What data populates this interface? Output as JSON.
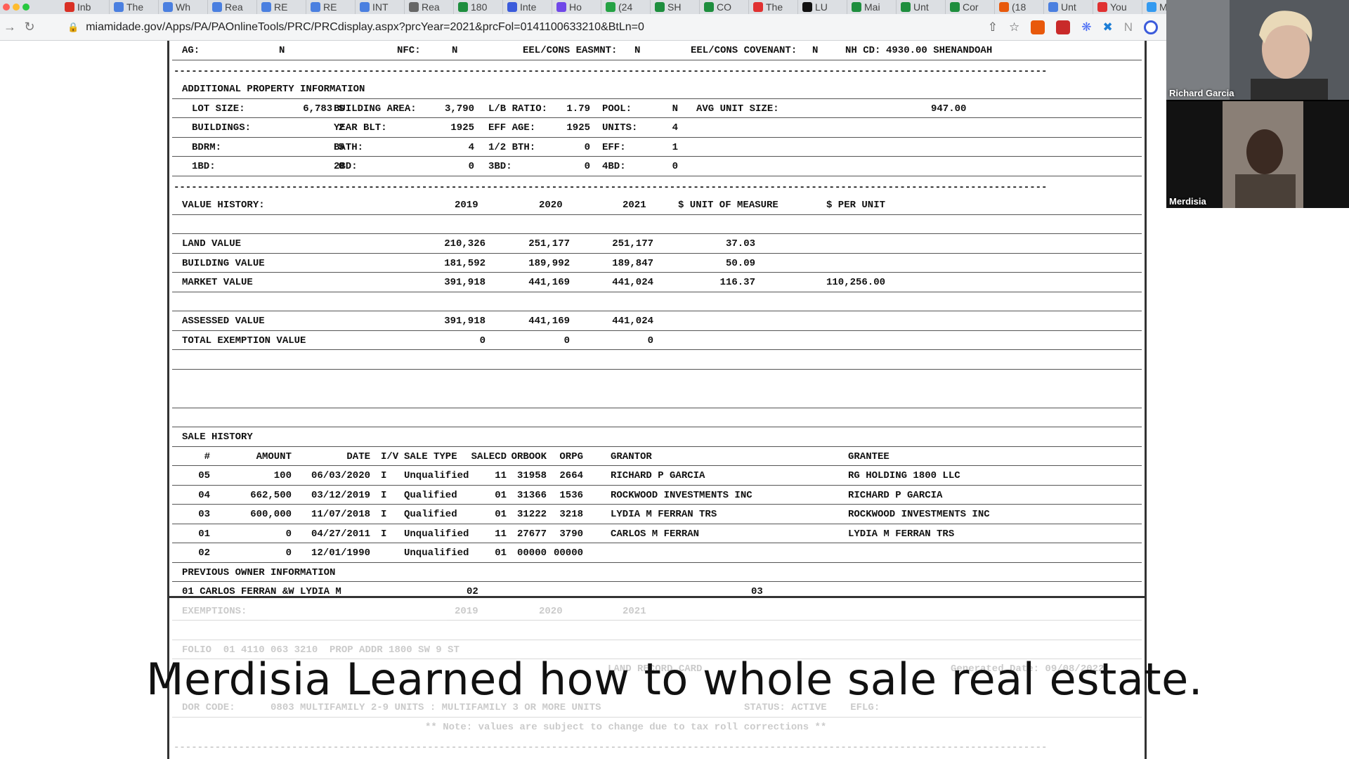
{
  "browser": {
    "tabs": [
      {
        "label": "Inb",
        "color": "#d93025"
      },
      {
        "label": "The",
        "color": "#4a7fe0"
      },
      {
        "label": "Wh",
        "color": "#4a7fe0"
      },
      {
        "label": "Rea",
        "color": "#4a7fe0"
      },
      {
        "label": "RE",
        "color": "#4a7fe0"
      },
      {
        "label": "RE",
        "color": "#4a7fe0"
      },
      {
        "label": "INT",
        "color": "#4a7fe0"
      },
      {
        "label": "Rea",
        "color": "#666"
      },
      {
        "label": "180",
        "color": "#1e8e3e"
      },
      {
        "label": "Inte",
        "color": "#3b5bdb"
      },
      {
        "label": "Ho",
        "color": "#7048e8"
      },
      {
        "label": "(24",
        "color": "#25a244"
      },
      {
        "label": "SH",
        "color": "#1e8e3e"
      },
      {
        "label": "CO",
        "color": "#1e8e3e"
      },
      {
        "label": "The",
        "color": "#e03131"
      },
      {
        "label": "LU",
        "color": "#111"
      },
      {
        "label": "Mai",
        "color": "#1e8e3e"
      },
      {
        "label": "Unt",
        "color": "#1e8e3e"
      },
      {
        "label": "Cor",
        "color": "#1e8e3e"
      },
      {
        "label": "(18",
        "color": "#e8590c"
      },
      {
        "label": "Unt",
        "color": "#4a7fe0"
      },
      {
        "label": "You",
        "color": "#e03131"
      },
      {
        "label": "Mo",
        "color": "#339af0"
      }
    ],
    "url": "miamidade.gov/Apps/PA/PAOnlineTools/PRC/PRCdisplay.aspx?prcYear=2021&prcFol=0141100633210&BtLn=0"
  },
  "document": {
    "top_row": {
      "ag_label": "AG:",
      "ag_value": "N",
      "nfc_label": "NFC:",
      "nfc_value": "N",
      "eel_easmnt_label": "EEL/CONS EASMNT:",
      "eel_easmnt_value": "N",
      "eel_cov_label": "EEL/CONS COVENANT:",
      "eel_cov_value": "N",
      "nh_cd_label": "NH CD:",
      "nh_cd_value": "4930.00 SHENANDOAH"
    },
    "dashes": "----------------------------------------------------------------------------------------------------------------------------------------------------",
    "additional_title": "ADDITIONAL PROPERTY INFORMATION",
    "additional_rows": [
      [
        {
          "label": "LOT SIZE:",
          "value": "6,783 S"
        },
        {
          "label": "BUILDING AREA:",
          "value": "3,790"
        },
        {
          "label": "L/B RATIO:",
          "value": "1.79"
        },
        {
          "label": "POOL:",
          "value": "N"
        },
        {
          "label": "AVG UNIT SIZE:",
          "value": "947.00"
        }
      ],
      [
        {
          "label": "BUILDINGS:",
          "value": "2"
        },
        {
          "label": "YEAR BLT:",
          "value": "1925"
        },
        {
          "label": "EFF AGE:",
          "value": "1925"
        },
        {
          "label": "UNITS:",
          "value": "4"
        }
      ],
      [
        {
          "label": "BDRM:",
          "value": "5"
        },
        {
          "label": "BATH:",
          "value": "4"
        },
        {
          "label": "1/2 BTH:",
          "value": "0"
        },
        {
          "label": "EFF:",
          "value": "1"
        }
      ],
      [
        {
          "label": "1BD:",
          "value": "0"
        },
        {
          "label": "2BD:",
          "value": "0"
        },
        {
          "label": "3BD:",
          "value": "0"
        },
        {
          "label": "4BD:",
          "value": "0"
        }
      ]
    ],
    "value_history": {
      "title": "VALUE HISTORY:",
      "years": [
        "2019",
        "2020",
        "2021"
      ],
      "unit_header": "$ UNIT OF MEASURE",
      "per_unit_header": "$ PER UNIT",
      "land": {
        "label": "LAND VALUE",
        "values": [
          "210,326",
          "251,177",
          "251,177"
        ],
        "unit": "37.03",
        "per": ""
      },
      "building": {
        "label": "BUILDING VALUE",
        "values": [
          "181,592",
          "189,992",
          "189,847"
        ],
        "unit": "50.09",
        "per": ""
      },
      "market": {
        "label": "MARKET VALUE",
        "values": [
          "391,918",
          "441,169",
          "441,024"
        ],
        "unit": "116.37",
        "per": "110,256.00"
      },
      "assessed": {
        "label": "ASSESSED VALUE",
        "values": [
          "391,918",
          "441,169",
          "441,024"
        ]
      },
      "exemption": {
        "label": "TOTAL EXEMPTION VALUE",
        "values": [
          "0",
          "0",
          "0"
        ]
      }
    },
    "sale_history": {
      "title": "SALE HISTORY",
      "headers": [
        "#",
        "AMOUNT",
        "DATE",
        "I/V",
        "SALE TYPE",
        "SALECD",
        "ORBOOK",
        "ORPG",
        "GRANTOR",
        "GRANTEE"
      ],
      "rows": [
        [
          "05",
          "100",
          "06/03/2020",
          "I",
          "Unqualified",
          "11",
          "31958",
          "2664",
          "RICHARD P GARCIA",
          "RG HOLDING 1800 LLC"
        ],
        [
          "04",
          "662,500",
          "03/12/2019",
          "I",
          "Qualified",
          "01",
          "31366",
          "1536",
          "ROCKWOOD INVESTMENTS INC",
          "RICHARD P GARCIA"
        ],
        [
          "03",
          "600,000",
          "11/07/2018",
          "I",
          "Qualified",
          "01",
          "31222",
          "3218",
          "LYDIA M FERRAN TRS",
          "ROCKWOOD INVESTMENTS INC"
        ],
        [
          "01",
          "0",
          "04/27/2011",
          "I",
          "Unqualified",
          "11",
          "27677",
          "3790",
          "CARLOS M FERRAN",
          "LYDIA M FERRAN TRS"
        ],
        [
          "02",
          "0",
          "12/01/1990",
          "",
          "Unqualified",
          "01",
          "00000",
          "00000",
          "",
          ""
        ]
      ]
    },
    "previous_owner": {
      "title": "PREVIOUS OWNER INFORMATION",
      "line": "01 CARLOS FERRAN &W LYDIA M",
      "code_a": "02",
      "code_b": "03"
    },
    "faded": {
      "exemptions_label": "EXEMPTIONS:",
      "years": [
        "2019",
        "2020",
        "2021"
      ],
      "folio_line": "FOLIO  01 4110 063 3210  PROP ADDR 1800 SW 9 ST",
      "land_record": "LAND RECORD CARD",
      "generated": "Generated Date: 09/08/2022",
      "dor_line": "DOR CODE:      0803 MULTIFAMILY 2-9 UNITS : MULTIFAMILY 3 OR MORE UNITS",
      "status": "STATUS: ACTIVE    EFLG:",
      "note": "** Note: values are subject to change due to tax roll corrections **"
    }
  },
  "video_call": {
    "participants": [
      {
        "name": "Richard Garcia"
      },
      {
        "name": "Merdisia"
      }
    ]
  },
  "caption": "Merdisia Learned how to whole sale real estate."
}
